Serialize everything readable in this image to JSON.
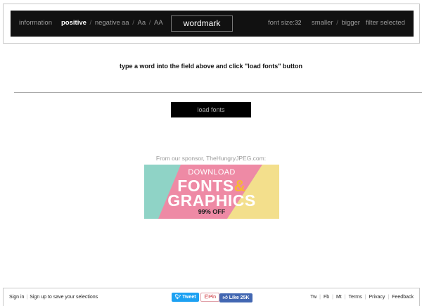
{
  "topbar": {
    "information": "information",
    "positive": "positive",
    "sep1": "/",
    "negative": "negative",
    "case_lower": "aa",
    "sep2": "/",
    "case_title": "Aa",
    "sep3": "/",
    "case_upper": "AA",
    "word_value": "wordmark",
    "font_size_label": "font size:",
    "font_size_value": "32",
    "smaller": "smaller",
    "sep4": "/",
    "bigger": "bigger",
    "filter_selected": "filter selected"
  },
  "main": {
    "instruction": "type a word into the field above and click \"load fonts\" button",
    "load_button": "load fonts"
  },
  "sponsor": {
    "text": "From our sponsor, TheHungryJPEG.com:",
    "banner_line1": "DOWNLOAD",
    "banner_line2": "FONTS",
    "banner_amp": "&",
    "banner_line3": "GRAPHICS",
    "banner_line4": "99% OFF",
    "colors": {
      "teal": "#8fd3c6",
      "pink": "#ee8aa5",
      "yellow": "#f3df8c"
    }
  },
  "footer": {
    "sign_in": "Sign in",
    "sep": "|",
    "sign_up": "Sign up to save your selections",
    "tweet": "Tweet",
    "pin": "Pin",
    "like": "Like 25K",
    "links": [
      "Tw",
      "Fb",
      "Mt",
      "Terms",
      "Privacy",
      "Feedback"
    ]
  }
}
